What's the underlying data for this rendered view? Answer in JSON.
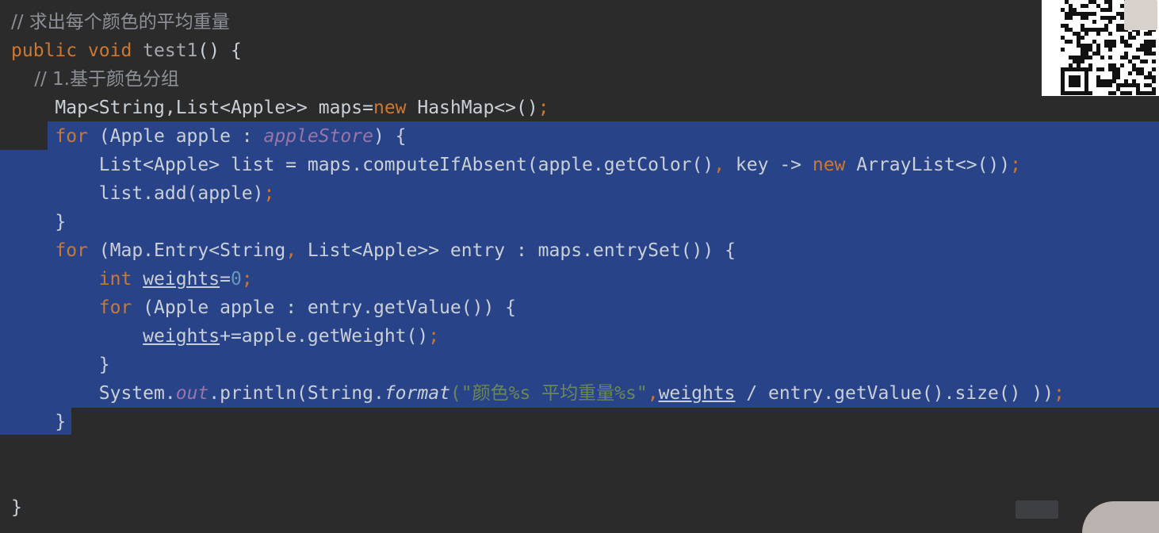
{
  "editor": {
    "lines": [
      {
        "tokens": [
          {
            "t": "// 求出每个颜色的平均重量",
            "c": "cm cn"
          }
        ]
      },
      {
        "tokens": [
          {
            "t": "public void ",
            "c": "kw"
          },
          {
            "t": "test1",
            "c": "fn"
          },
          {
            "t": "() {",
            "c": "pl"
          }
        ]
      },
      {
        "tokens": [
          {
            "t": "    // 1.基于颜色分组",
            "c": "cm cn"
          }
        ]
      },
      {
        "tokens": [
          {
            "t": "    Map<String,List<Apple>> maps=",
            "c": "pl"
          },
          {
            "t": "new",
            "c": "kw"
          },
          {
            "t": " HashMap<>()",
            "c": "pl"
          },
          {
            "t": ";",
            "c": "kw"
          }
        ]
      },
      {
        "tokens": [
          {
            "t": "    ",
            "c": "pl"
          },
          {
            "t": "for",
            "c": "kw"
          },
          {
            "t": " (Apple apple : ",
            "c": "pl"
          },
          {
            "t": "appleStore",
            "c": "fld"
          },
          {
            "t": ") {",
            "c": "pl"
          }
        ]
      },
      {
        "tokens": [
          {
            "t": "        List<Apple> list = maps.computeIfAbsent(apple.getColor()",
            "c": "pl"
          },
          {
            "t": ",",
            "c": "kw"
          },
          {
            "t": " key -> ",
            "c": "pl"
          },
          {
            "t": "new",
            "c": "kw"
          },
          {
            "t": " ArrayList<>())",
            "c": "pl"
          },
          {
            "t": ";",
            "c": "kw"
          }
        ]
      },
      {
        "tokens": [
          {
            "t": "        list.add(apple)",
            "c": "pl"
          },
          {
            "t": ";",
            "c": "kw"
          }
        ]
      },
      {
        "tokens": [
          {
            "t": "    }",
            "c": "pl"
          }
        ]
      },
      {
        "tokens": [
          {
            "t": "    ",
            "c": "pl"
          },
          {
            "t": "for",
            "c": "kw"
          },
          {
            "t": " (Map.Entry<String",
            "c": "pl"
          },
          {
            "t": ",",
            "c": "kw"
          },
          {
            "t": " List<Apple>> entry : maps.entrySet()) {",
            "c": "pl"
          }
        ]
      },
      {
        "tokens": [
          {
            "t": "        ",
            "c": "pl"
          },
          {
            "t": "int",
            "c": "kw"
          },
          {
            "t": " ",
            "c": "pl"
          },
          {
            "t": "weights",
            "c": "pl ul"
          },
          {
            "t": "=",
            "c": "pl"
          },
          {
            "t": "0",
            "c": "num"
          },
          {
            "t": ";",
            "c": "kw"
          }
        ]
      },
      {
        "tokens": [
          {
            "t": "        ",
            "c": "pl"
          },
          {
            "t": "for",
            "c": "kw"
          },
          {
            "t": " (Apple apple : entry.getValue()) {",
            "c": "pl"
          }
        ]
      },
      {
        "tokens": [
          {
            "t": "            ",
            "c": "pl"
          },
          {
            "t": "weights",
            "c": "pl ul"
          },
          {
            "t": "+=apple.getWeight()",
            "c": "pl"
          },
          {
            "t": ";",
            "c": "kw"
          }
        ]
      },
      {
        "tokens": [
          {
            "t": "        }",
            "c": "pl"
          }
        ]
      },
      {
        "tokens": [
          {
            "t": "        System.",
            "c": "pl"
          },
          {
            "t": "out",
            "c": "fld"
          },
          {
            "t": ".println(String.",
            "c": "pl"
          },
          {
            "t": "format",
            "c": "pl it"
          },
          {
            "t": "(\"颜色%s 平均重量%s\"",
            "c": "st"
          },
          {
            "t": ",",
            "c": "kw"
          },
          {
            "t": "weights",
            "c": "pl ul"
          },
          {
            "t": " / entry.getValue().size() ))",
            "c": "pl"
          },
          {
            "t": ";",
            "c": "kw"
          }
        ]
      },
      {
        "tokens": [
          {
            "t": "    }",
            "c": "pl"
          }
        ]
      },
      {
        "tokens": []
      },
      {
        "tokens": []
      },
      {
        "tokens": [
          {
            "t": "}",
            "c": "pl"
          }
        ]
      }
    ]
  },
  "overlay": {
    "qr_code": "qr-code-image",
    "presenter_avatar": "presenter-thumbnail"
  }
}
